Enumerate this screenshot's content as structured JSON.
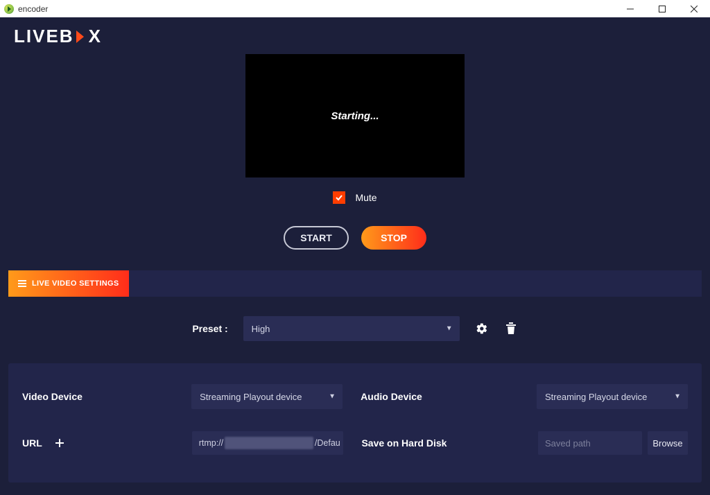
{
  "window": {
    "title": "encoder"
  },
  "brand": {
    "part1": "LIVEB",
    "part2": "X"
  },
  "preview": {
    "status": "Starting..."
  },
  "mute": {
    "label": "Mute",
    "checked": true
  },
  "controls": {
    "start": "START",
    "stop": "STOP"
  },
  "tabs": {
    "live_video_settings": "LIVE VIDEO SETTINGS"
  },
  "preset": {
    "label": "Preset :",
    "value": "High"
  },
  "panel": {
    "video_device_label": "Video Device",
    "video_device_value": "Streaming Playout device",
    "audio_device_label": "Audio Device",
    "audio_device_value": "Streaming Playout device",
    "url_label": "URL",
    "url_prefix": "rtmp://",
    "url_suffix": "/Defau",
    "save_disk_label": "Save on Hard Disk",
    "saved_path_placeholder": "Saved path",
    "browse_label": "Browse"
  }
}
